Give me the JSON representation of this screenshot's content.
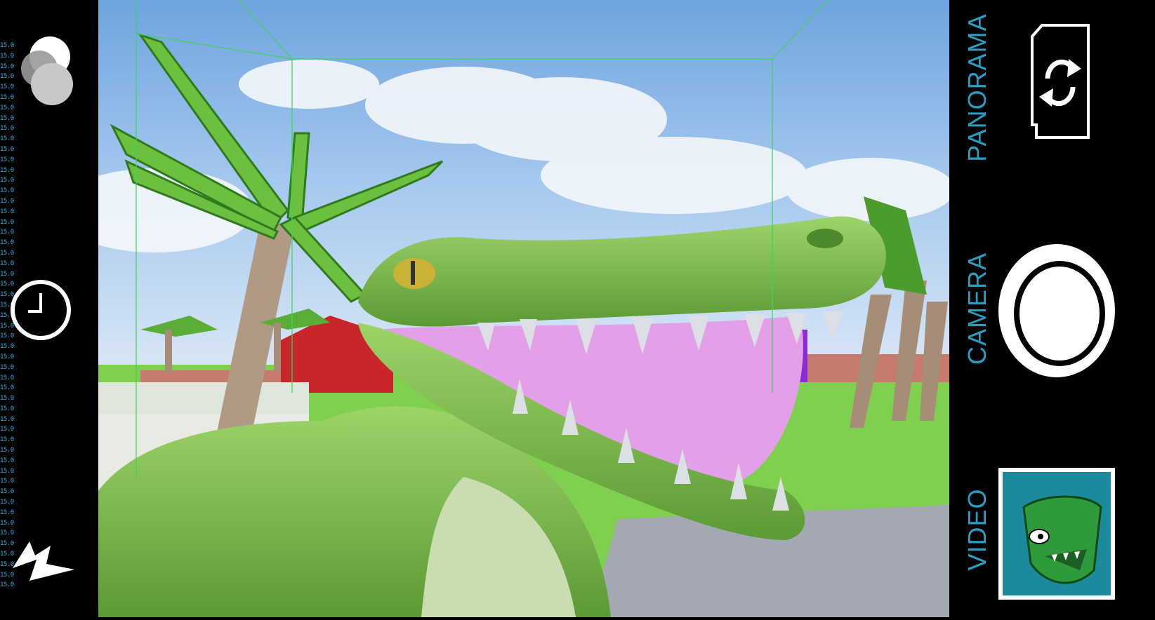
{
  "debug_overlay": {
    "values": [
      "15.0",
      "15.0",
      "15.0",
      "15.0",
      "15.0",
      "15.0",
      "15.0",
      "15.0",
      "15.0",
      "15.0",
      "15.0",
      "15.0",
      "15.0",
      "15.0",
      "15.0",
      "15.0",
      "15.0",
      "15.0",
      "15.0",
      "15.0",
      "15.0",
      "15.0",
      "15.0",
      "15.0",
      "15.0",
      "15.0",
      "15.0",
      "15.0",
      "15.0",
      "15.0",
      "15.0",
      "15.0",
      "15.0",
      "15.0",
      "15.0",
      "15.0",
      "15.0",
      "15.0",
      "15.0",
      "15.0",
      "15.0",
      "15.0",
      "15.0",
      "15.0",
      "15.0",
      "15.0",
      "15.0",
      "15.0",
      "15.0",
      "15.0",
      "15.0",
      "15.0",
      "15.0"
    ],
    "color": "#2fb4e6"
  },
  "left_controls": {
    "filter_icon": "filter-circles-icon",
    "timer_icon": "timer-icon",
    "flash_icon": "flash-icon"
  },
  "modes": {
    "panorama": "PANORAMA",
    "camera": "CAMERA",
    "video": "VIDEO",
    "color": "#2a9fc4"
  },
  "right_controls": {
    "switch_camera_icon": "switch-camera-icon",
    "shutter_icon": "shutter-button",
    "gallery_icon": "gallery-thumbnail"
  },
  "scene": {
    "sky_color": "#9ec6ea",
    "grass_color": "#7ed04e",
    "croc_color": "#7cbb4a",
    "mouth_color": "#e3a0e8",
    "guide_color": "#3fd35a"
  }
}
